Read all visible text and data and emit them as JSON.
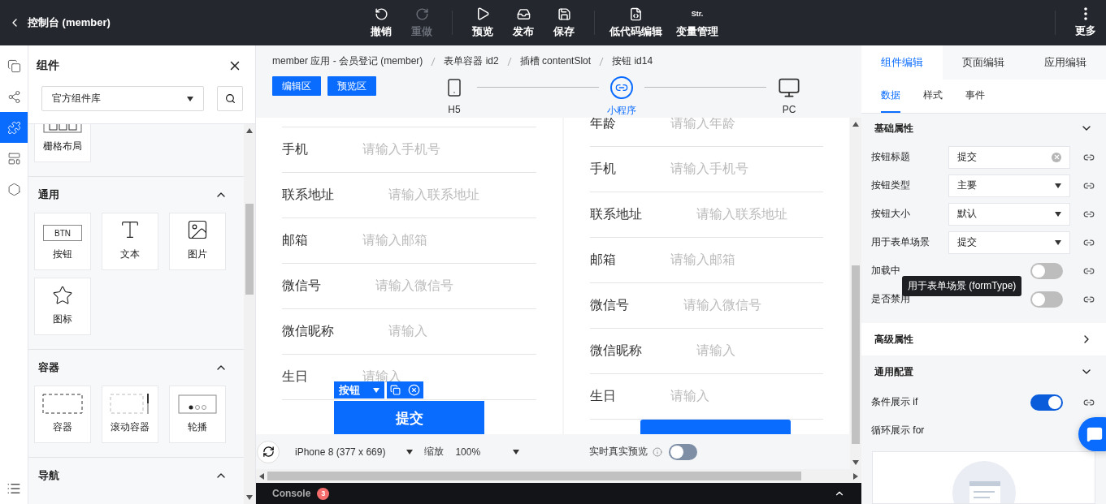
{
  "topbar": {
    "title": "控制台 (member)",
    "action_groups": [
      [
        {
          "label": "撤销",
          "kind": "undo",
          "disabled": false
        },
        {
          "label": "重做",
          "kind": "redo",
          "disabled": true
        }
      ],
      [
        {
          "label": "预览",
          "kind": "play",
          "disabled": false
        },
        {
          "label": "发布",
          "kind": "publish",
          "disabled": false
        },
        {
          "label": "保存",
          "kind": "save",
          "disabled": false
        }
      ],
      [
        {
          "label": "低代码编辑",
          "kind": "code",
          "disabled": false
        },
        {
          "label": "变量管理",
          "kind": "text_icon",
          "icon_text": "Str.",
          "disabled": false
        }
      ]
    ],
    "more": "更多"
  },
  "rail": [
    {
      "selected": false
    },
    {
      "selected": false
    },
    {
      "selected": true
    },
    {
      "selected": false
    },
    {
      "selected": false
    }
  ],
  "components_panel": {
    "title": "组件",
    "library": "官方组件库",
    "groups": [
      {
        "items": [
          {
            "label": "栅格布局",
            "kind": "grid"
          }
        ]
      },
      {
        "title": "通用",
        "expanded": true,
        "items": [
          {
            "label": "按钮",
            "kind": "button",
            "icon_text": "BTN"
          },
          {
            "label": "文本",
            "kind": "text"
          },
          {
            "label": "图片",
            "kind": "image"
          },
          {
            "label": "图标",
            "kind": "star"
          }
        ]
      },
      {
        "title": "容器",
        "expanded": true,
        "items": [
          {
            "label": "容器",
            "kind": "container"
          },
          {
            "label": "滚动容器",
            "kind": "scroll"
          },
          {
            "label": "轮播",
            "kind": "carousel"
          }
        ]
      },
      {
        "title": "导航",
        "expanded": true
      }
    ]
  },
  "canvas": {
    "breadcrumb": [
      "member 应用 - 会员登记 (member)",
      "表单容器 id2",
      "插槽 contentSlot",
      "按钮 id14"
    ],
    "modes": [
      "编辑区",
      "预览区"
    ],
    "devices": [
      {
        "label": "H5",
        "kind": "phone",
        "selected": false
      },
      {
        "label": "小程序",
        "kind": "miniapp",
        "selected": true
      },
      {
        "label": "PC",
        "kind": "monitor",
        "selected": false
      }
    ],
    "previews": [
      {
        "fields": [
          {
            "label": "手机",
            "placeholder": "请输入手机号"
          },
          {
            "label": "联系地址",
            "placeholder": "请输入联系地址"
          },
          {
            "label": "邮箱",
            "placeholder": "请输入邮箱"
          },
          {
            "label": "微信号",
            "placeholder": "请输入微信号"
          },
          {
            "label": "微信昵称",
            "placeholder": "请输入"
          },
          {
            "label": "生日",
            "placeholder": "请输入"
          }
        ],
        "button": "提交",
        "selected": true
      },
      {
        "fields": [
          {
            "label": "年龄",
            "placeholder": "请输入年龄"
          },
          {
            "label": "手机",
            "placeholder": "请输入手机号"
          },
          {
            "label": "联系地址",
            "placeholder": "请输入联系地址"
          },
          {
            "label": "邮箱",
            "placeholder": "请输入邮箱"
          },
          {
            "label": "微信号",
            "placeholder": "请输入微信号"
          },
          {
            "label": "微信昵称",
            "placeholder": "请输入"
          },
          {
            "label": "生日",
            "placeholder": "请输入"
          }
        ],
        "selected": false
      }
    ],
    "selection_label": "按钮",
    "device": "iPhone 8 (377 x 669)",
    "zoom_label": "缩放",
    "zoom": "100%",
    "realtime": {
      "label": "实时真实预览",
      "on": false
    },
    "console": {
      "label": "Console",
      "count": "3",
      "expanded": false
    }
  },
  "props_panel": {
    "tabs": [
      {
        "label": "组件编辑",
        "selected": true
      },
      {
        "label": "页面编辑",
        "selected": false
      },
      {
        "label": "应用编辑",
        "selected": false
      }
    ],
    "subtabs": [
      {
        "label": "数据",
        "selected": true
      },
      {
        "label": "样式",
        "selected": false
      },
      {
        "label": "事件",
        "selected": false
      }
    ],
    "sections": [
      {
        "title": "基础属性",
        "expanded": true,
        "rows": [
          {
            "label": "按钮标题",
            "kind": "input",
            "value": "提交"
          },
          {
            "label": "按钮类型",
            "kind": "select",
            "value": "主要"
          },
          {
            "label": "按钮大小",
            "kind": "select",
            "value": "默认"
          },
          {
            "label": "用于表单场景",
            "kind": "select",
            "value": "提交"
          },
          {
            "label": "加载中",
            "kind": "switch",
            "on": false
          },
          {
            "label": "是否禁用",
            "kind": "switch",
            "on": false
          }
        ]
      },
      {
        "title": "高级属性",
        "expanded": false
      },
      {
        "title": "通用配置",
        "expanded": true,
        "rows": [
          {
            "label": "条件展示 if",
            "kind": "switch",
            "on": true
          },
          {
            "label": "循环展示 for",
            "kind": "binding"
          }
        ]
      }
    ],
    "tooltip": "用于表单场景 (formType)"
  }
}
